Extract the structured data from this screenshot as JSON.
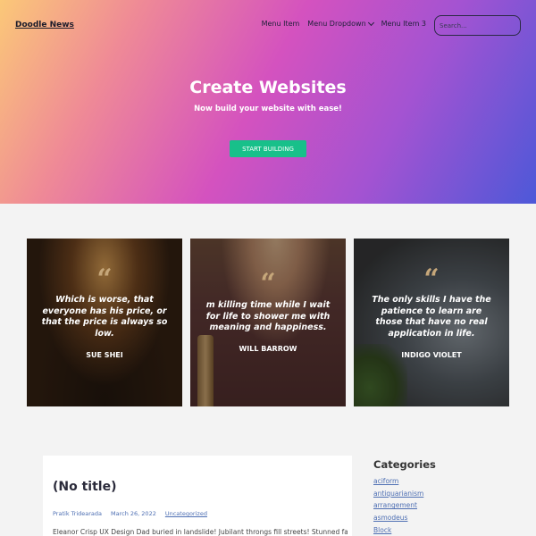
{
  "header": {
    "brand": "Doodle News",
    "nav": [
      "Menu Item",
      "Menu Dropdown",
      "Menu Item 3"
    ],
    "search_placeholder": "Search..."
  },
  "hero": {
    "title": "Create Websites",
    "subtitle": "Now build your website with ease!",
    "cta_label": "START BUILDING"
  },
  "testimonials": [
    {
      "quote_mark": "“",
      "text": "Which is worse, that everyone has his price, or that the price is always so low.",
      "author": "SUE SHEI"
    },
    {
      "quote_mark": "“",
      "text": "m killing time while I wait for life to shower me with meaning and happiness.",
      "author": "WILL BARROW"
    },
    {
      "quote_mark": "“",
      "text": "The only skills I have the patience to learn are those that have no real application in life.",
      "author": "INDIGO VIOLET"
    }
  ],
  "post": {
    "title": "(No title)",
    "author": "Pratik Tridearada",
    "date": "March 26, 2022",
    "category": "Uncategorized",
    "excerpt": "Eleanor Crisp UX Design Dad buried in landslide! Jubilant throngs fill streets! Stunned father"
  },
  "sidebar": {
    "heading": "Categories",
    "items": [
      "aciform",
      "antiquarianism",
      "arrangement",
      "asmodeus",
      "Block"
    ]
  },
  "colors": {
    "cta": "#18c08a",
    "link": "#4e6fb3"
  }
}
